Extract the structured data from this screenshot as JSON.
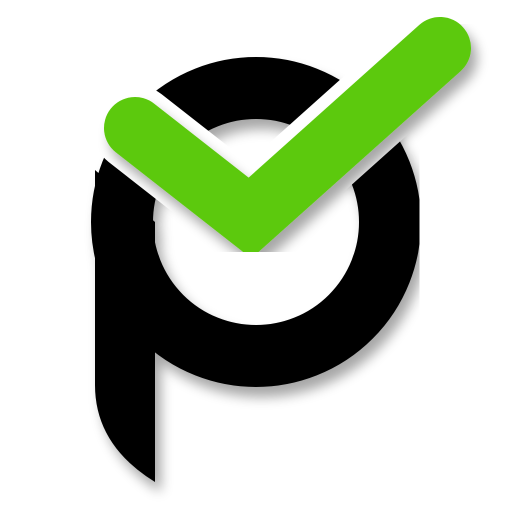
{
  "logo": {
    "name": "p-letter-checkmark-logo",
    "letter_color": "#000000",
    "check_color": "#5bc90a",
    "background_color": "#ffffff",
    "icons": [
      "p-letter-icon",
      "checkmark-icon"
    ]
  }
}
